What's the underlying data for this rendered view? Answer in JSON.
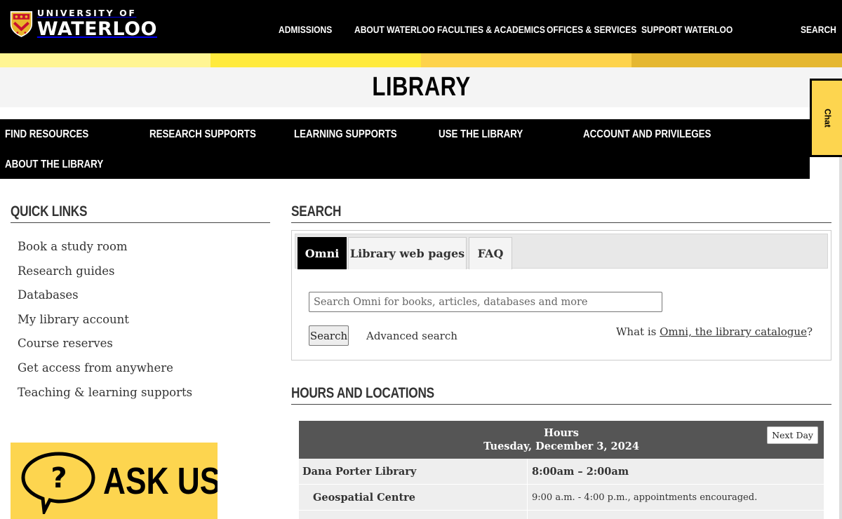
{
  "header": {
    "logo": {
      "line1": "UNIVERSITY OF",
      "line2": "WATERLOO"
    },
    "nav": [
      "ADMISSIONS",
      "ABOUT WATERLOO",
      "FACULTIES & ACADEMICS",
      "OFFICES & SERVICES",
      "SUPPORT WATERLOO"
    ],
    "search_label": "SEARCH"
  },
  "colors": {
    "strip": [
      "#fff593",
      "#ffea3d",
      "#fed34c",
      "#e5b731"
    ],
    "accent": "#fdd54f",
    "black": "#000000"
  },
  "site_title": "LIBRARY",
  "chat_label": "Chat",
  "section_nav": [
    "FIND RESOURCES",
    "RESEARCH SUPPORTS",
    "LEARNING SUPPORTS",
    "USE THE LIBRARY",
    "ACCOUNT AND PRIVILEGES",
    "ABOUT THE LIBRARY"
  ],
  "quick_links": {
    "title": "QUICK LINKS",
    "items": [
      "Book a study room",
      "Research guides",
      "Databases",
      "My library account",
      "Course reserves",
      "Get access from anywhere",
      "Teaching & learning supports"
    ]
  },
  "ask_us": {
    "label": "ASK US",
    "icon": "question-bubble-icon"
  },
  "search": {
    "title": "SEARCH",
    "tabs": [
      "Omni",
      "Library web pages",
      "FAQ"
    ],
    "active_tab": "Omni",
    "placeholder": "Search Omni for books, articles, databases and more",
    "value": "",
    "button": "Search",
    "advanced": "Advanced search",
    "what_prefix": "What is ",
    "what_link": "Omni, the library catalogue",
    "what_suffix": "?"
  },
  "hours": {
    "title": "HOURS AND LOCATIONS",
    "table_title": "Hours",
    "date": "Tuesday, December 3, 2024",
    "next_button": "Next Day",
    "rows": [
      {
        "location": "Dana Porter Library",
        "hours": "8:00am – 2:00am"
      },
      {
        "location": "Geospatial Centre",
        "hours": "9:00 a.m. - 4:00 p.m., appointments encouraged."
      }
    ]
  }
}
